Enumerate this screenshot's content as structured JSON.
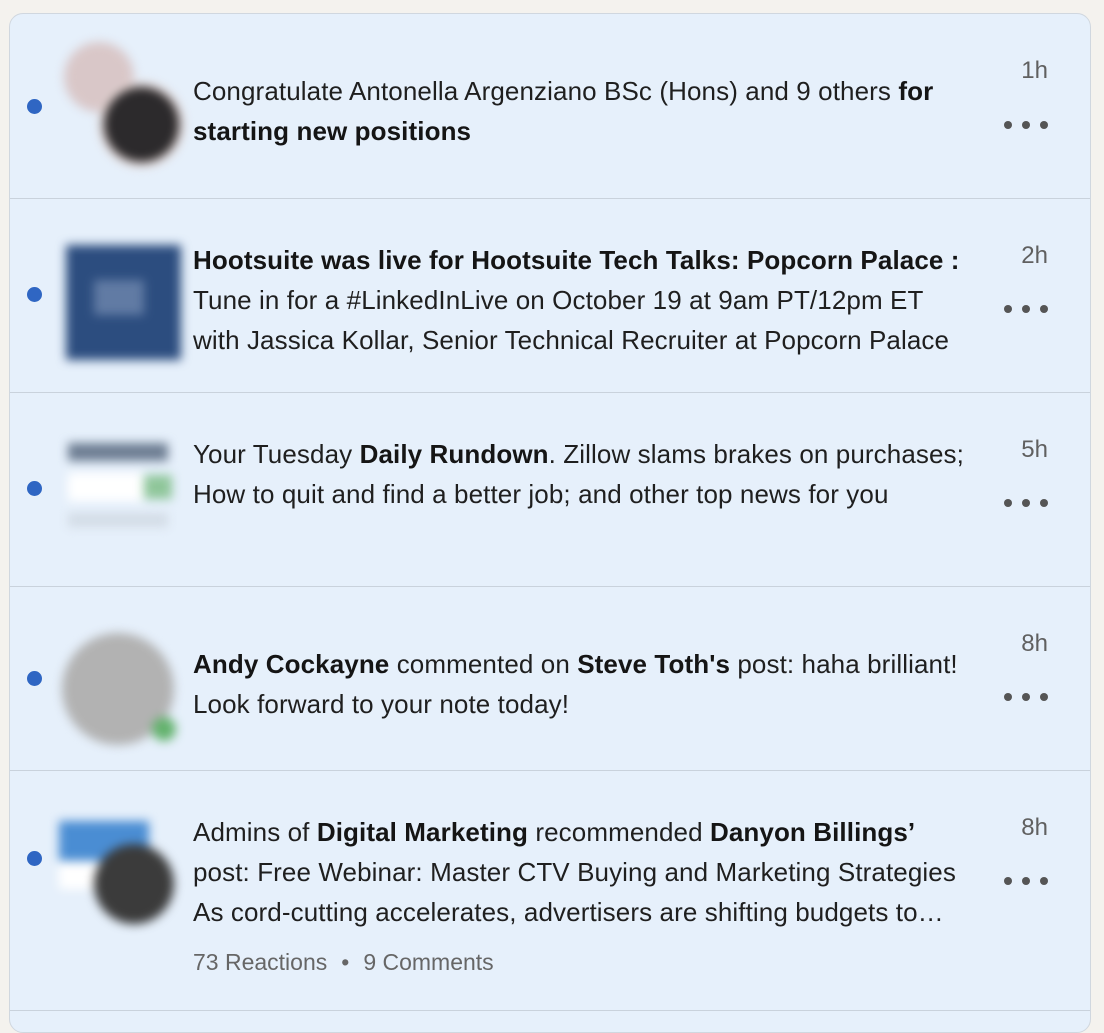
{
  "notifications": [
    {
      "time": "1h",
      "parts": [
        {
          "text": "Congratulate Antonella Argenziano BSc (Hons) and 9 others ",
          "bold": false
        },
        {
          "text": "for starting new positions",
          "bold": true
        }
      ]
    },
    {
      "time": "2h",
      "parts": [
        {
          "text": "Hootsuite was live for Hootsuite Tech Talks: Popcorn Palace :",
          "bold": true
        },
        {
          "text": " Tune in for a #LinkedInLive on October 19 at 9am PT/12pm ET with Jassica Kollar, Senior Technical Recruiter at Popcorn Palace",
          "bold": false
        }
      ]
    },
    {
      "time": "5h",
      "parts": [
        {
          "text": "Your Tuesday ",
          "bold": false
        },
        {
          "text": "Daily Rundown",
          "bold": true
        },
        {
          "text": ". Zillow slams brakes on purchases; How to quit and find a better job; and other top news for you",
          "bold": false
        }
      ]
    },
    {
      "time": "8h",
      "parts": [
        {
          "text": "Andy Cockayne",
          "bold": true
        },
        {
          "text": " commented on ",
          "bold": false
        },
        {
          "text": "Steve Toth's",
          "bold": true
        },
        {
          "text": " post: haha brilliant! Look forward to your note today!",
          "bold": false
        }
      ]
    },
    {
      "time": "8h",
      "parts": [
        {
          "text": "Admins of ",
          "bold": false
        },
        {
          "text": "Digital Marketing",
          "bold": true
        },
        {
          "text": " recommended ",
          "bold": false
        },
        {
          "text": "Danyon Billings’",
          "bold": true
        },
        {
          "text": " post: Free Webinar: Master CTV Buying and Marketing Strategies As cord-cutting accelerates, advertisers are shifting budgets to connected TV",
          "bold": false
        }
      ],
      "reactions": "73 Reactions",
      "separator": "•",
      "comments": "9 Comments"
    }
  ],
  "icons": {
    "unread": "unread-dot-icon",
    "more": "more-options-icon"
  },
  "colors": {
    "unread_dot": "#2f66c3",
    "unread_background": "#e6f0fb"
  }
}
